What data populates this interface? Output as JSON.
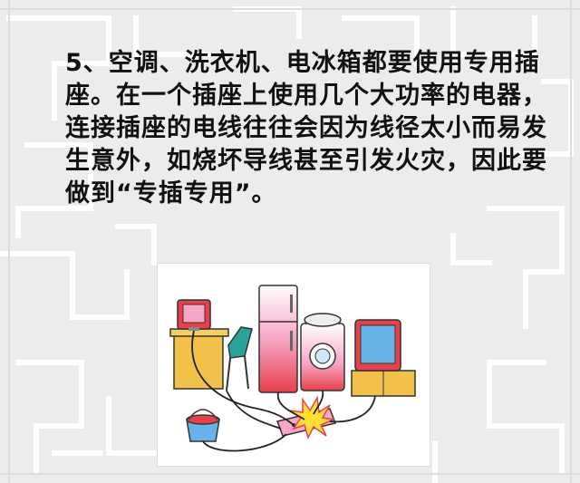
{
  "text": {
    "lines": [
      "5、空调、洗衣机、电冰箱都要使用专用插",
      "座。在一个插座上使用几个大功率的电器，",
      "连接插座的电线往往会因为线径太小而易发",
      "生意外，如烧坏导线甚至引发火灾，因此要",
      "做到“专插专用”。"
    ]
  },
  "colors": {
    "background": "#eeeeee",
    "maze_lines": "#ffffff",
    "text": "#111111",
    "appliance_red": "#e8404a",
    "appliance_pink": "#f6a6c6",
    "furniture_orange": "#f2c14a",
    "chair_teal": "#27a39a",
    "screen_blue": "#69b4e6",
    "spark_yellow": "#ffe033"
  },
  "illustration": {
    "icons": [
      "computer-icon",
      "chair-icon",
      "refrigerator-icon",
      "washing-machine-icon",
      "television-icon",
      "bucket-icon",
      "power-strip-icon",
      "spark-icon"
    ]
  }
}
